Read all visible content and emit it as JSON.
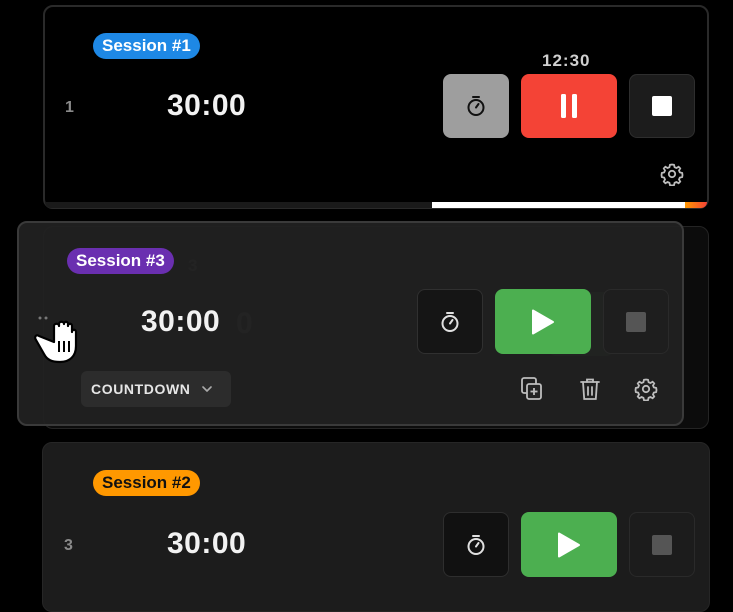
{
  "sessions": {
    "s1": {
      "row": "1",
      "badge": "Session #1",
      "time": "30:00",
      "current": "12:30",
      "badge_color": "#1e88e5"
    },
    "s3": {
      "badge": "Session #3",
      "time": "30:00",
      "mode": "COUNTDOWN",
      "badge_color": "#6a2fb0"
    },
    "s2": {
      "row": "3",
      "badge": "Session #2",
      "time": "30:00",
      "badge_color": "#ff9800"
    }
  },
  "ghost": {
    "badge_tail": "3",
    "time_tail": "0"
  },
  "icons": [
    "timer-icon",
    "pause-icon",
    "stop-icon",
    "play-icon",
    "gear-icon",
    "duplicate-icon",
    "trash-icon",
    "chevron-down-icon",
    "grab-hand-cursor-icon"
  ],
  "colors": {
    "pause": "#f44336",
    "play": "#4caf50",
    "timer_active": "#9e9e9e",
    "progress": "#ffffff"
  }
}
